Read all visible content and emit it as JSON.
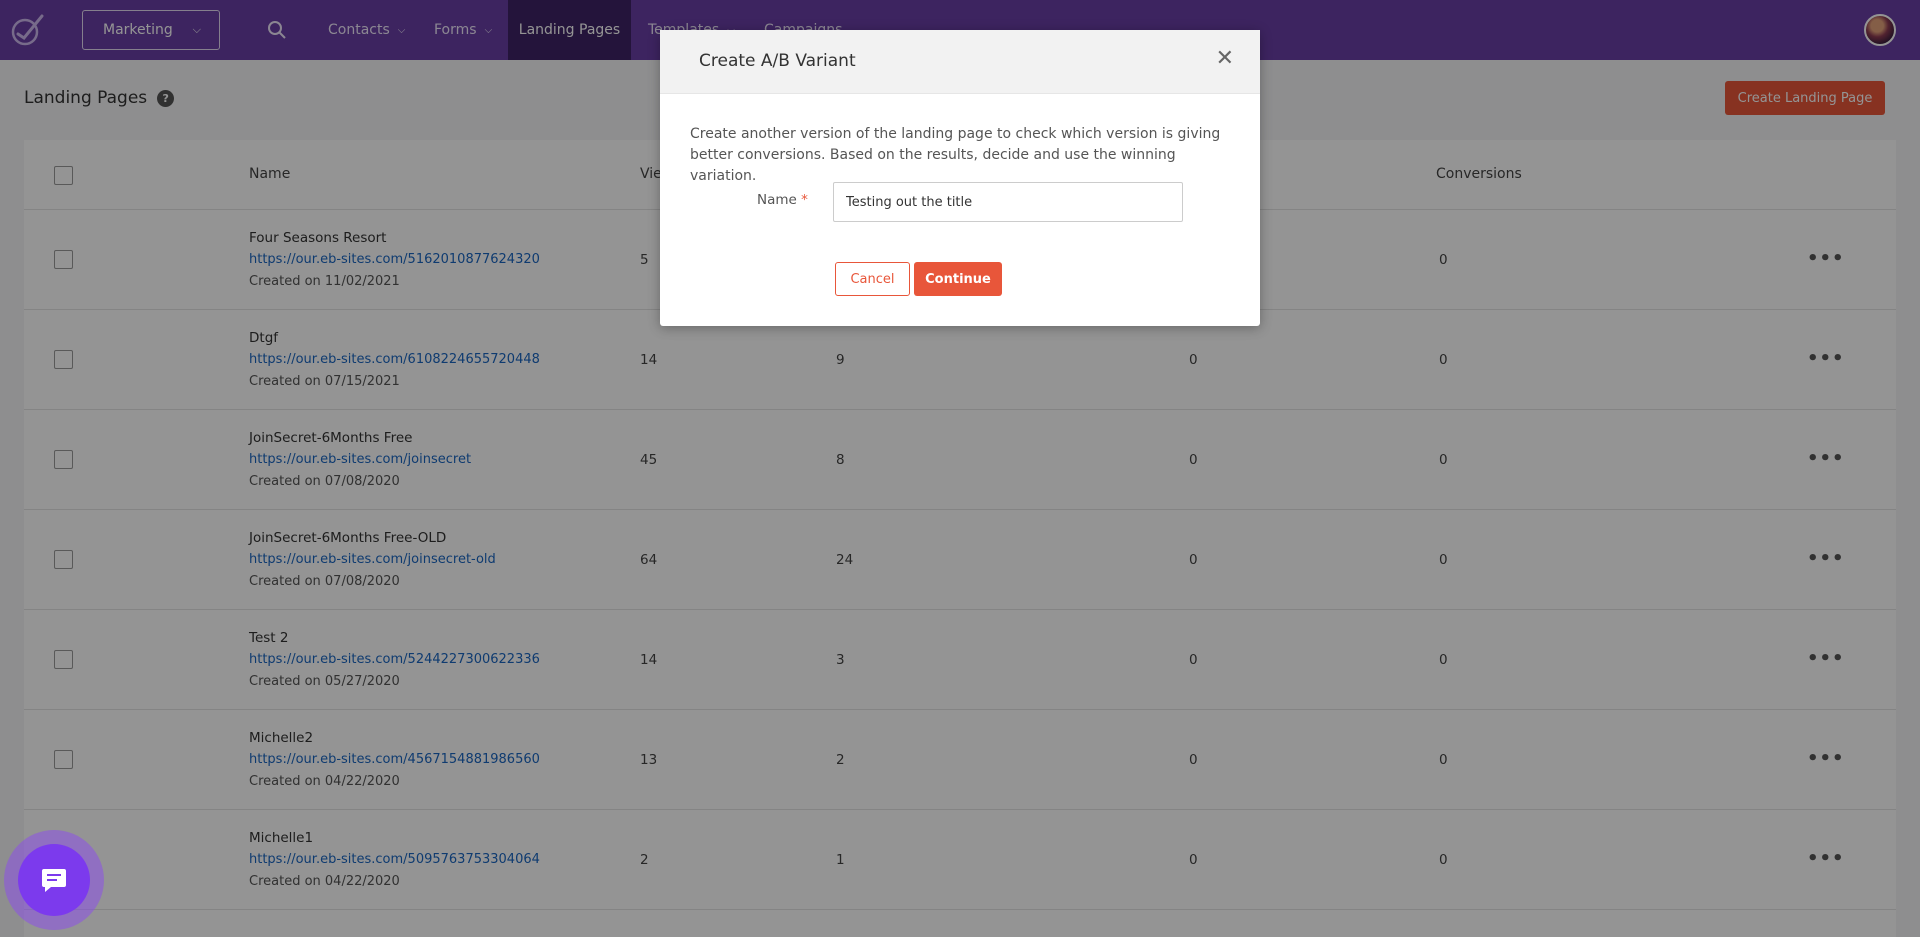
{
  "nav": {
    "app_select": "Marketing",
    "items": [
      {
        "label": "Contacts"
      },
      {
        "label": "Forms"
      },
      {
        "label": "Landing Pages"
      },
      {
        "label": "Templates"
      },
      {
        "label": "Campaigns"
      }
    ]
  },
  "page": {
    "title": "Landing Pages",
    "create_button": "Create Landing Page"
  },
  "table": {
    "headers": {
      "name": "Name",
      "views": "Views",
      "conversions": "Conversions"
    },
    "rows": [
      {
        "name": "Four Seasons Resort",
        "url": "https://our.eb-sites.com/5162010877624320",
        "created": "Created on 11/02/2021",
        "views": "5",
        "col2": "",
        "col3": "",
        "conversions": "0"
      },
      {
        "name": "Dtgf",
        "url": "https://our.eb-sites.com/6108224655720448",
        "created": "Created on 07/15/2021",
        "views": "14",
        "col2": "9",
        "col3": "0",
        "conversions": "0"
      },
      {
        "name": "JoinSecret-6Months Free",
        "url": "https://our.eb-sites.com/joinsecret",
        "created": "Created on 07/08/2020",
        "views": "45",
        "col2": "8",
        "col3": "0",
        "conversions": "0"
      },
      {
        "name": "JoinSecret-6Months Free-OLD",
        "url": "https://our.eb-sites.com/joinsecret-old",
        "created": "Created on 07/08/2020",
        "views": "64",
        "col2": "24",
        "col3": "0",
        "conversions": "0"
      },
      {
        "name": "Test 2",
        "url": "https://our.eb-sites.com/5244227300622336",
        "created": "Created on 05/27/2020",
        "views": "14",
        "col2": "3",
        "col3": "0",
        "conversions": "0"
      },
      {
        "name": "Michelle2",
        "url": "https://our.eb-sites.com/4567154881986560",
        "created": "Created on 04/22/2020",
        "views": "13",
        "col2": "2",
        "col3": "0",
        "conversions": "0"
      },
      {
        "name": "Michelle1",
        "url": "https://our.eb-sites.com/5095763753304064",
        "created": "Created on 04/22/2020",
        "views": "2",
        "col2": "1",
        "col3": "0",
        "conversions": "0"
      }
    ]
  },
  "modal": {
    "title": "Create A/B Variant",
    "description": "Create another version of the landing page to check which version is giving better conversions. Based on the results, decide and use the winning variation.",
    "name_label": "Name",
    "required_mark": "*",
    "name_value": "Testing out the title",
    "cancel": "Cancel",
    "continue": "Continue"
  },
  "colors": {
    "nav_bg": "#6a3fa6",
    "accent": "#e8563a",
    "link": "#1a66c2"
  }
}
